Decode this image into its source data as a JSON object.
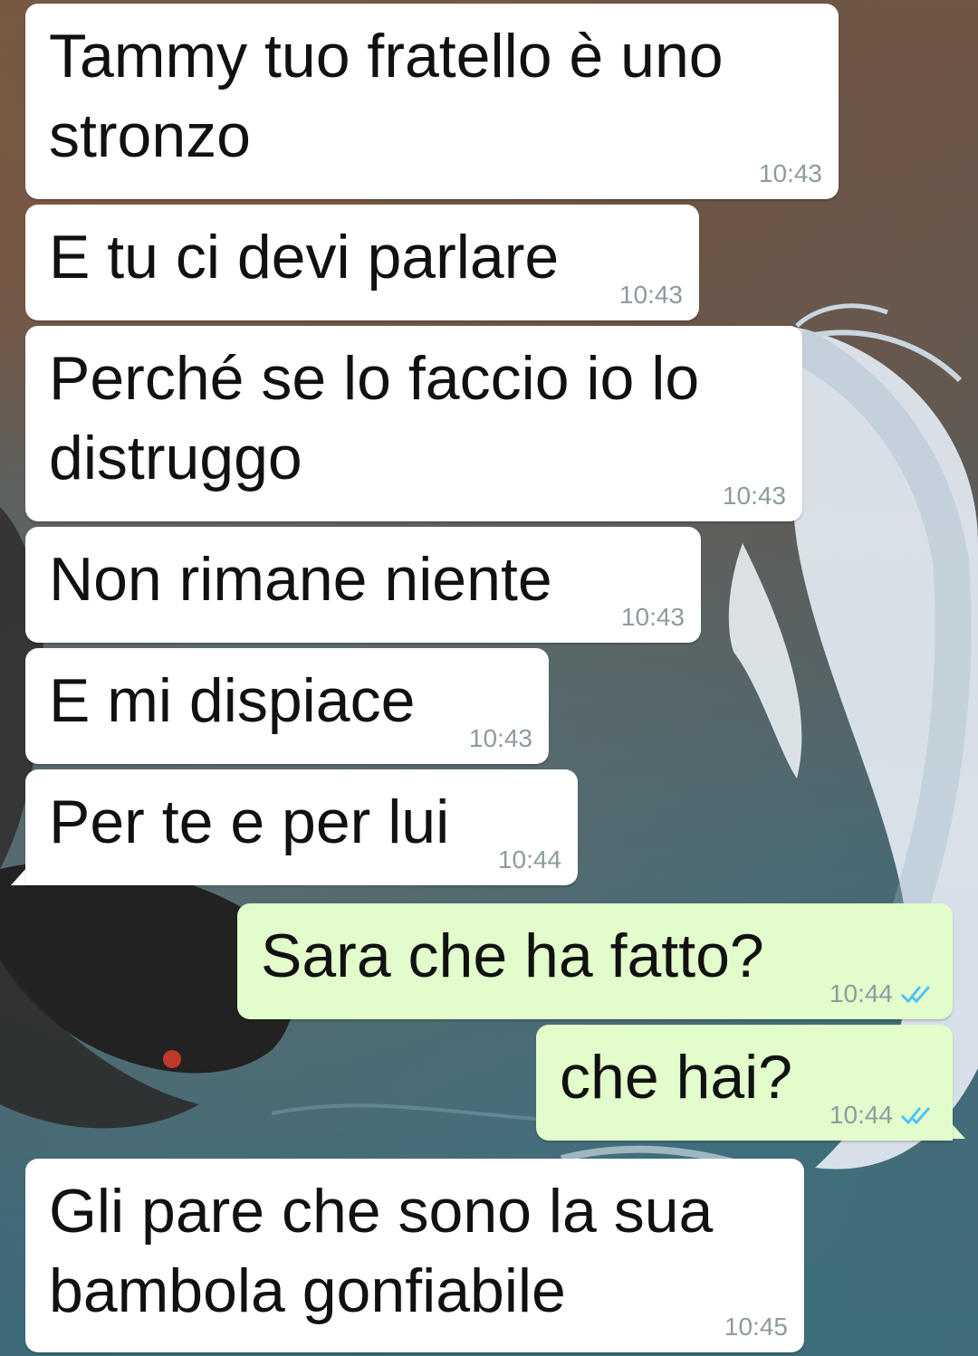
{
  "messages": [
    {
      "direction": "in",
      "text": "Tammy tuo fratello è uno\nstronzo",
      "time": "10:43"
    },
    {
      "direction": "in",
      "text": "E tu ci devi parlare",
      "time": "10:43"
    },
    {
      "direction": "in",
      "text": "Perché se lo faccio io lo\ndistruggo",
      "time": "10:43"
    },
    {
      "direction": "in",
      "text": "Non rimane niente",
      "time": "10:43"
    },
    {
      "direction": "in",
      "text": "E mi dispiace",
      "time": "10:43"
    },
    {
      "direction": "in",
      "text": "Per te e per lui",
      "time": "10:44"
    },
    {
      "direction": "out",
      "text": "Sara che ha fatto?",
      "time": "10:44",
      "status": "read"
    },
    {
      "direction": "out",
      "text": "che hai?",
      "time": "10:44",
      "status": "read"
    },
    {
      "direction": "in",
      "text": "Gli pare che sono la sua\nbambola gonfiabile",
      "time": "10:45"
    }
  ],
  "colors": {
    "incoming_bubble": "#ffffff",
    "outgoing_bubble": "#e2fccb",
    "read_ticks": "#4fc3f7",
    "timestamp": "#8d9b9f"
  },
  "icons": {
    "read_receipt": "double-check-icon",
    "wallpaper": "koi-fish-yin-yang-wallpaper"
  }
}
